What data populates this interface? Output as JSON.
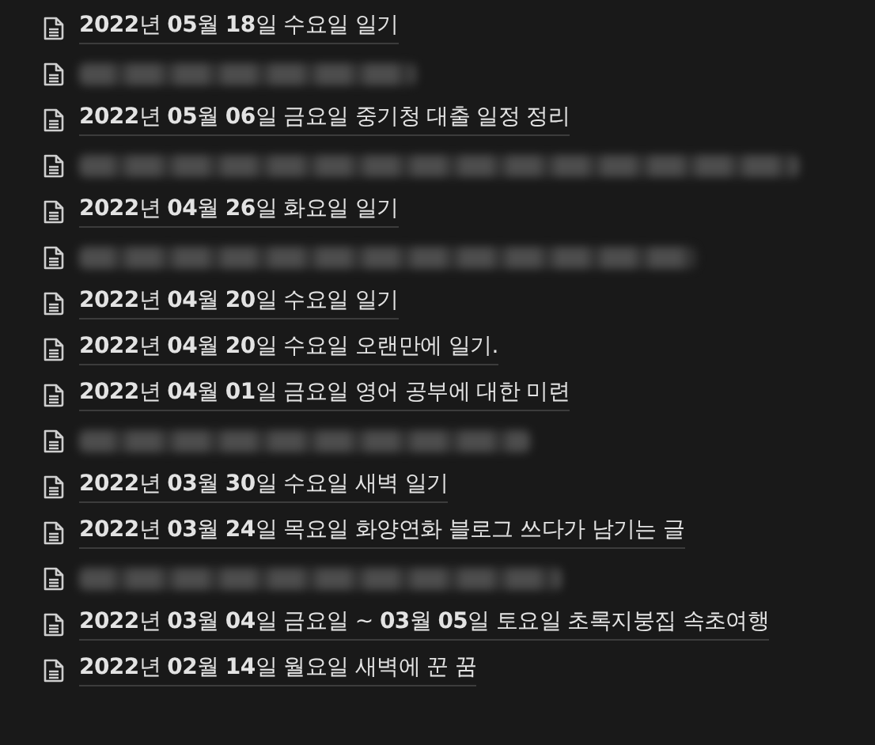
{
  "pages": [
    {
      "kind": "link",
      "title": "**2022**년 **05**월 **18**일 수요일 일기"
    },
    {
      "kind": "redacted"
    },
    {
      "kind": "link",
      "title": "**2022**년 **05**월 **06**일 금요일 중기청 대출 일정 정리"
    },
    {
      "kind": "redacted"
    },
    {
      "kind": "link",
      "title": "**2022**년 **04**월 **26**일 화요일 일기"
    },
    {
      "kind": "redacted"
    },
    {
      "kind": "link",
      "title": "**2022**년 **04**월 **20**일 수요일 일기"
    },
    {
      "kind": "link",
      "title": "**2022**년 **04**월 **20**일 수요일 오랜만에 일기."
    },
    {
      "kind": "link",
      "title": "**2022**년 **04**월 **01**일 금요일 영어 공부에 대한 미련"
    },
    {
      "kind": "redacted"
    },
    {
      "kind": "link",
      "title": "**2022**년 **03**월 **30**일 수요일 새벽 일기"
    },
    {
      "kind": "link",
      "title": "**2022**년 **03**월 **24**일 목요일 화양연화 블로그 쓰다가 남기는 글"
    },
    {
      "kind": "redacted"
    },
    {
      "kind": "link",
      "title": "**2022**년 **03**월 **04**일 금요일 ~ **03**월 **05**일 토요일 초록지붕집 속초여행"
    },
    {
      "kind": "link",
      "title": "**2022**년 **02**월 **14**일 월요일 새벽에 꾼 꿈"
    }
  ]
}
